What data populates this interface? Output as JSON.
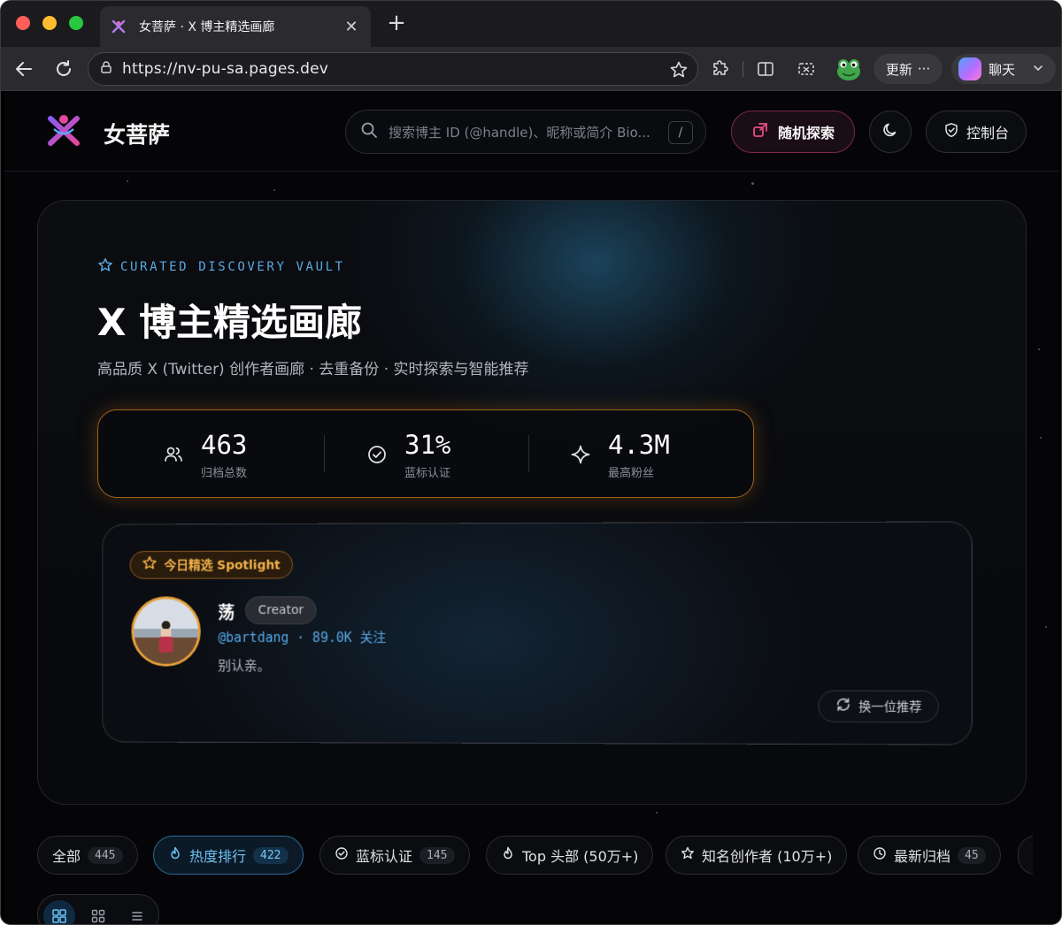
{
  "browser": {
    "tab_title": "女菩萨 · X 博主精选画廊",
    "url": "https://nv-pu-sa.pages.dev",
    "update_label": "更新",
    "chat_label": "聊天"
  },
  "header": {
    "site_name": "女菩萨",
    "search_placeholder": "搜索博主 ID (@handle)、昵称或简介 Bio...",
    "search_shortcut": "/",
    "random_label": "随机探索",
    "console_label": "控制台"
  },
  "hero": {
    "eyebrow": "CURATED DISCOVERY VAULT",
    "title": "X 博主精选画廊",
    "subtitle": "高品质 X (Twitter) 创作者画廊 · 去重备份 · 实时探索与智能推荐",
    "stats": [
      {
        "value": "463",
        "label": "归档总数",
        "icon": "users-icon"
      },
      {
        "value": "31%",
        "label": "蓝标认证",
        "icon": "verified-icon"
      },
      {
        "value": "4.3M",
        "label": "最高粉丝",
        "icon": "sparkle-icon"
      }
    ]
  },
  "spotlight": {
    "badge": "今日精选 Spotlight",
    "name": "荡",
    "tag": "Creator",
    "handle_line": "@bartdang · 89.0K 关注",
    "bio": "别认亲。",
    "next_label": "换一位推荐"
  },
  "filters": [
    {
      "label": "全部",
      "count": "445"
    },
    {
      "label": "热度排行",
      "count": "422"
    },
    {
      "label": "蓝标认证",
      "count": "145"
    },
    {
      "label": "Top 头部 (50万+)",
      "count": ""
    },
    {
      "label": "知名创作者 (10万+)",
      "count": ""
    },
    {
      "label": "最新归档",
      "count": "45"
    }
  ],
  "colors": {
    "accent": "#56a9e6",
    "gold": "#e6a13c",
    "pink": "#e84b8a"
  }
}
